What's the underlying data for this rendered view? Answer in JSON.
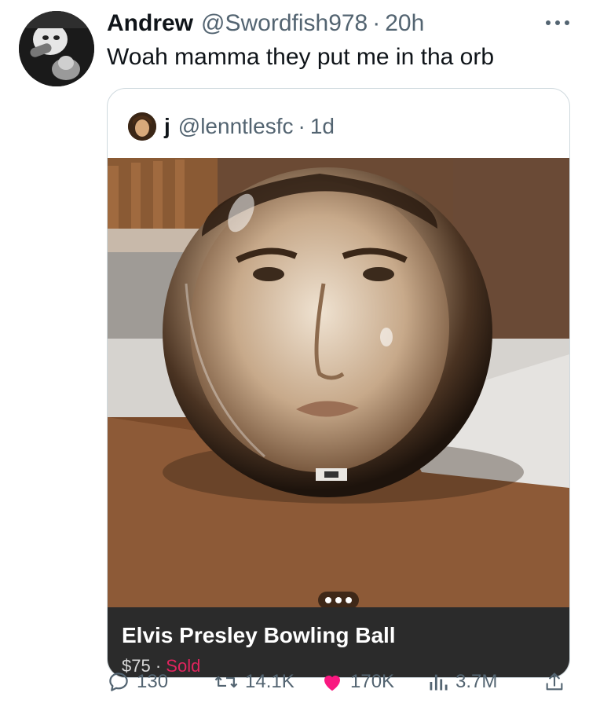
{
  "tweet": {
    "author_name": "Andrew",
    "author_handle": "@Swordfish978",
    "separator": "·",
    "time": "20h",
    "text": "Woah mamma they put me in tha orb"
  },
  "quoted": {
    "author_name": "j",
    "author_handle": "@lenntlesfc",
    "separator": "·",
    "time": "1d",
    "caption_title": "Elvis Presley Bowling Ball",
    "caption_price": "$75",
    "caption_separator": " · ",
    "caption_status": "Sold"
  },
  "actions": {
    "replies": "130",
    "retweets": "14.1K",
    "likes": "170K",
    "views": "3.7M"
  },
  "icons": {
    "reply": "reply-icon",
    "retweet": "retweet-icon",
    "like": "heart-icon",
    "views": "analytics-icon",
    "share": "share-icon",
    "more": "more-icon"
  },
  "colors": {
    "like_heart": "#f91880",
    "secondary_text": "#536471",
    "sold": "#e0245e",
    "caption_bg": "#2b2b2b"
  }
}
